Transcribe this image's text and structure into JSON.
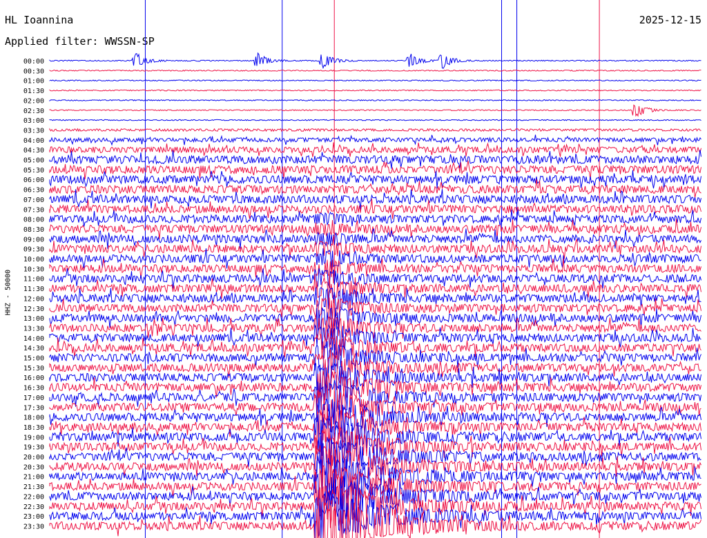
{
  "header": {
    "station": "HL Ioannina",
    "date": "2025-12-15",
    "filter": "Applied filter: WWSSN-SP",
    "channel_label": "HHZ - 50000"
  },
  "chart_data": {
    "type": "line",
    "title": "HL Ioannina",
    "subtitle": "Applied filter: WWSSN-SP",
    "ylabel": "HHZ - 50000",
    "row_labels": [
      "00:00",
      "00:30",
      "01:00",
      "01:30",
      "02:00",
      "02:30",
      "03:00",
      "03:30",
      "04:00",
      "04:30",
      "05:00",
      "05:30",
      "06:00",
      "06:30",
      "07:00",
      "07:30",
      "08:00",
      "08:30",
      "09:00",
      "09:30",
      "10:00",
      "10:30",
      "11:00",
      "11:30",
      "12:00",
      "12:30",
      "13:00",
      "13:30",
      "14:00",
      "14:30",
      "15:00",
      "15:30",
      "16:00",
      "16:30",
      "17:00",
      "17:30",
      "18:00",
      "18:30",
      "19:00",
      "19:30",
      "20:00",
      "20:30",
      "21:00",
      "21:30",
      "22:00",
      "22:30",
      "23:00",
      "23:30"
    ],
    "row_minutes": 30,
    "line_colors": [
      "#0000ee",
      "#ee1144"
    ],
    "noise_level_by_row": [
      1,
      1,
      1,
      1,
      1,
      1,
      1,
      2,
      3,
      4,
      5,
      5,
      5,
      5,
      5,
      5,
      5,
      5,
      5,
      5,
      5,
      5,
      5,
      5,
      5,
      5,
      5,
      5,
      5,
      5,
      5,
      5,
      5,
      5,
      5,
      5,
      5,
      5,
      5,
      5,
      5,
      5,
      5,
      5,
      5,
      5,
      5,
      5
    ],
    "event_markers": [
      {
        "minute": 4.4,
        "color": "#0000ee"
      },
      {
        "minute": 10.7,
        "color": "#0000ee"
      },
      {
        "minute": 13.1,
        "color": "#ee1144"
      },
      {
        "minute": 20.8,
        "color": "#0000ee"
      },
      {
        "minute": 21.5,
        "color": "#0000ee"
      },
      {
        "minute": 25.3,
        "color": "#ee1144"
      }
    ],
    "major_event": {
      "start_minute": 12.3,
      "onset_row_label": "08:00",
      "color": "#ee1144"
    },
    "events": [
      {
        "row_label": "00:00",
        "minute": 4.0
      },
      {
        "row_label": "00:00",
        "minute": 9.6
      },
      {
        "row_label": "00:00",
        "minute": 12.6
      },
      {
        "row_label": "00:00",
        "minute": 16.6
      },
      {
        "row_label": "00:00",
        "minute": 18.1
      },
      {
        "row_label": "02:30",
        "minute": 27.0
      }
    ]
  }
}
